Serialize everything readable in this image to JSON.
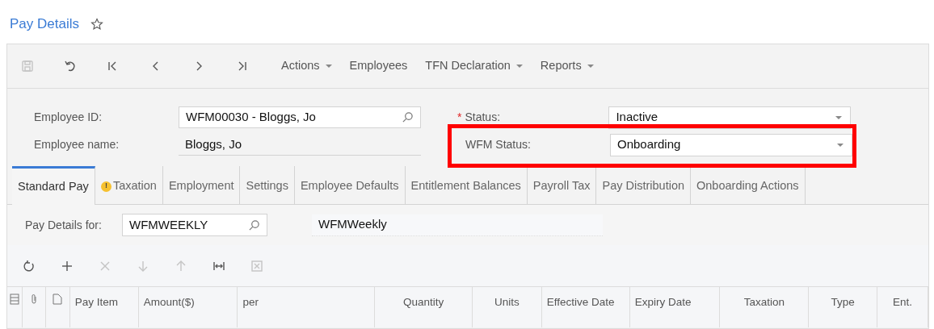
{
  "title": "Pay Details",
  "favorite": false,
  "toolbar": [
    {
      "kind": "save",
      "disabled": true
    },
    {
      "kind": "undo",
      "disabled": false
    },
    {
      "kind": "first",
      "disabled": false
    },
    {
      "kind": "prev",
      "disabled": false
    },
    {
      "kind": "next",
      "disabled": false
    },
    {
      "kind": "last",
      "disabled": false
    },
    {
      "kind": "menu",
      "label": "Actions",
      "dropdown": true
    },
    {
      "kind": "menu",
      "label": "Employees",
      "dropdown": false
    },
    {
      "kind": "menu",
      "label": "TFN Declaration",
      "dropdown": true
    },
    {
      "kind": "menu",
      "label": "Reports",
      "dropdown": true
    }
  ],
  "employee_id": {
    "label": "Employee ID:",
    "value": "WFM00030 - Bloggs, Jo"
  },
  "employee_name": {
    "label": "Employee name:",
    "value": "Bloggs, Jo"
  },
  "status": {
    "label": "Status:",
    "required_mark": "*",
    "value": "Inactive"
  },
  "wfm_status": {
    "label": "WFM Status:",
    "value": "Onboarding",
    "highlighted": true
  },
  "tabs": [
    {
      "label": "Standard Pay",
      "selected": true,
      "warning": false
    },
    {
      "label": "Taxation",
      "selected": false,
      "warning": true,
      "warning_mark": "!"
    },
    {
      "label": "Employment",
      "selected": false,
      "warning": false
    },
    {
      "label": "Settings",
      "selected": false,
      "warning": false
    },
    {
      "label": "Employee Defaults",
      "selected": false,
      "warning": false
    },
    {
      "label": "Entitlement Balances",
      "selected": false,
      "warning": false
    },
    {
      "label": "Payroll Tax",
      "selected": false,
      "warning": false
    },
    {
      "label": "Pay Distribution",
      "selected": false,
      "warning": false
    },
    {
      "label": "Onboarding Actions",
      "selected": false,
      "warning": false
    }
  ],
  "pay_details_for": {
    "label": "Pay Details for:",
    "value": "WFMWEEKLY",
    "description": "WFMWeekly"
  },
  "grid_toolbar": [
    {
      "kind": "refresh",
      "disabled": false
    },
    {
      "kind": "add",
      "disabled": false
    },
    {
      "kind": "delete",
      "disabled": true
    },
    {
      "kind": "down",
      "disabled": true
    },
    {
      "kind": "up",
      "disabled": true
    },
    {
      "kind": "fit",
      "disabled": false
    },
    {
      "kind": "excel",
      "disabled": true
    }
  ],
  "columns": [
    {
      "kind": "files"
    },
    {
      "kind": "attach"
    },
    {
      "kind": "note"
    },
    {
      "kind": "text",
      "label": "Pay Item"
    },
    {
      "kind": "text",
      "label": "Amount($)"
    },
    {
      "kind": "text",
      "label": "per"
    },
    {
      "kind": "text",
      "label": "Quantity"
    },
    {
      "kind": "text",
      "label": "Units"
    },
    {
      "kind": "text",
      "label": "Effective Date"
    },
    {
      "kind": "text",
      "label": "Expiry Date"
    },
    {
      "kind": "text",
      "label": "Taxation"
    },
    {
      "kind": "text",
      "label": "Type"
    },
    {
      "kind": "text",
      "label": "Ent."
    }
  ]
}
